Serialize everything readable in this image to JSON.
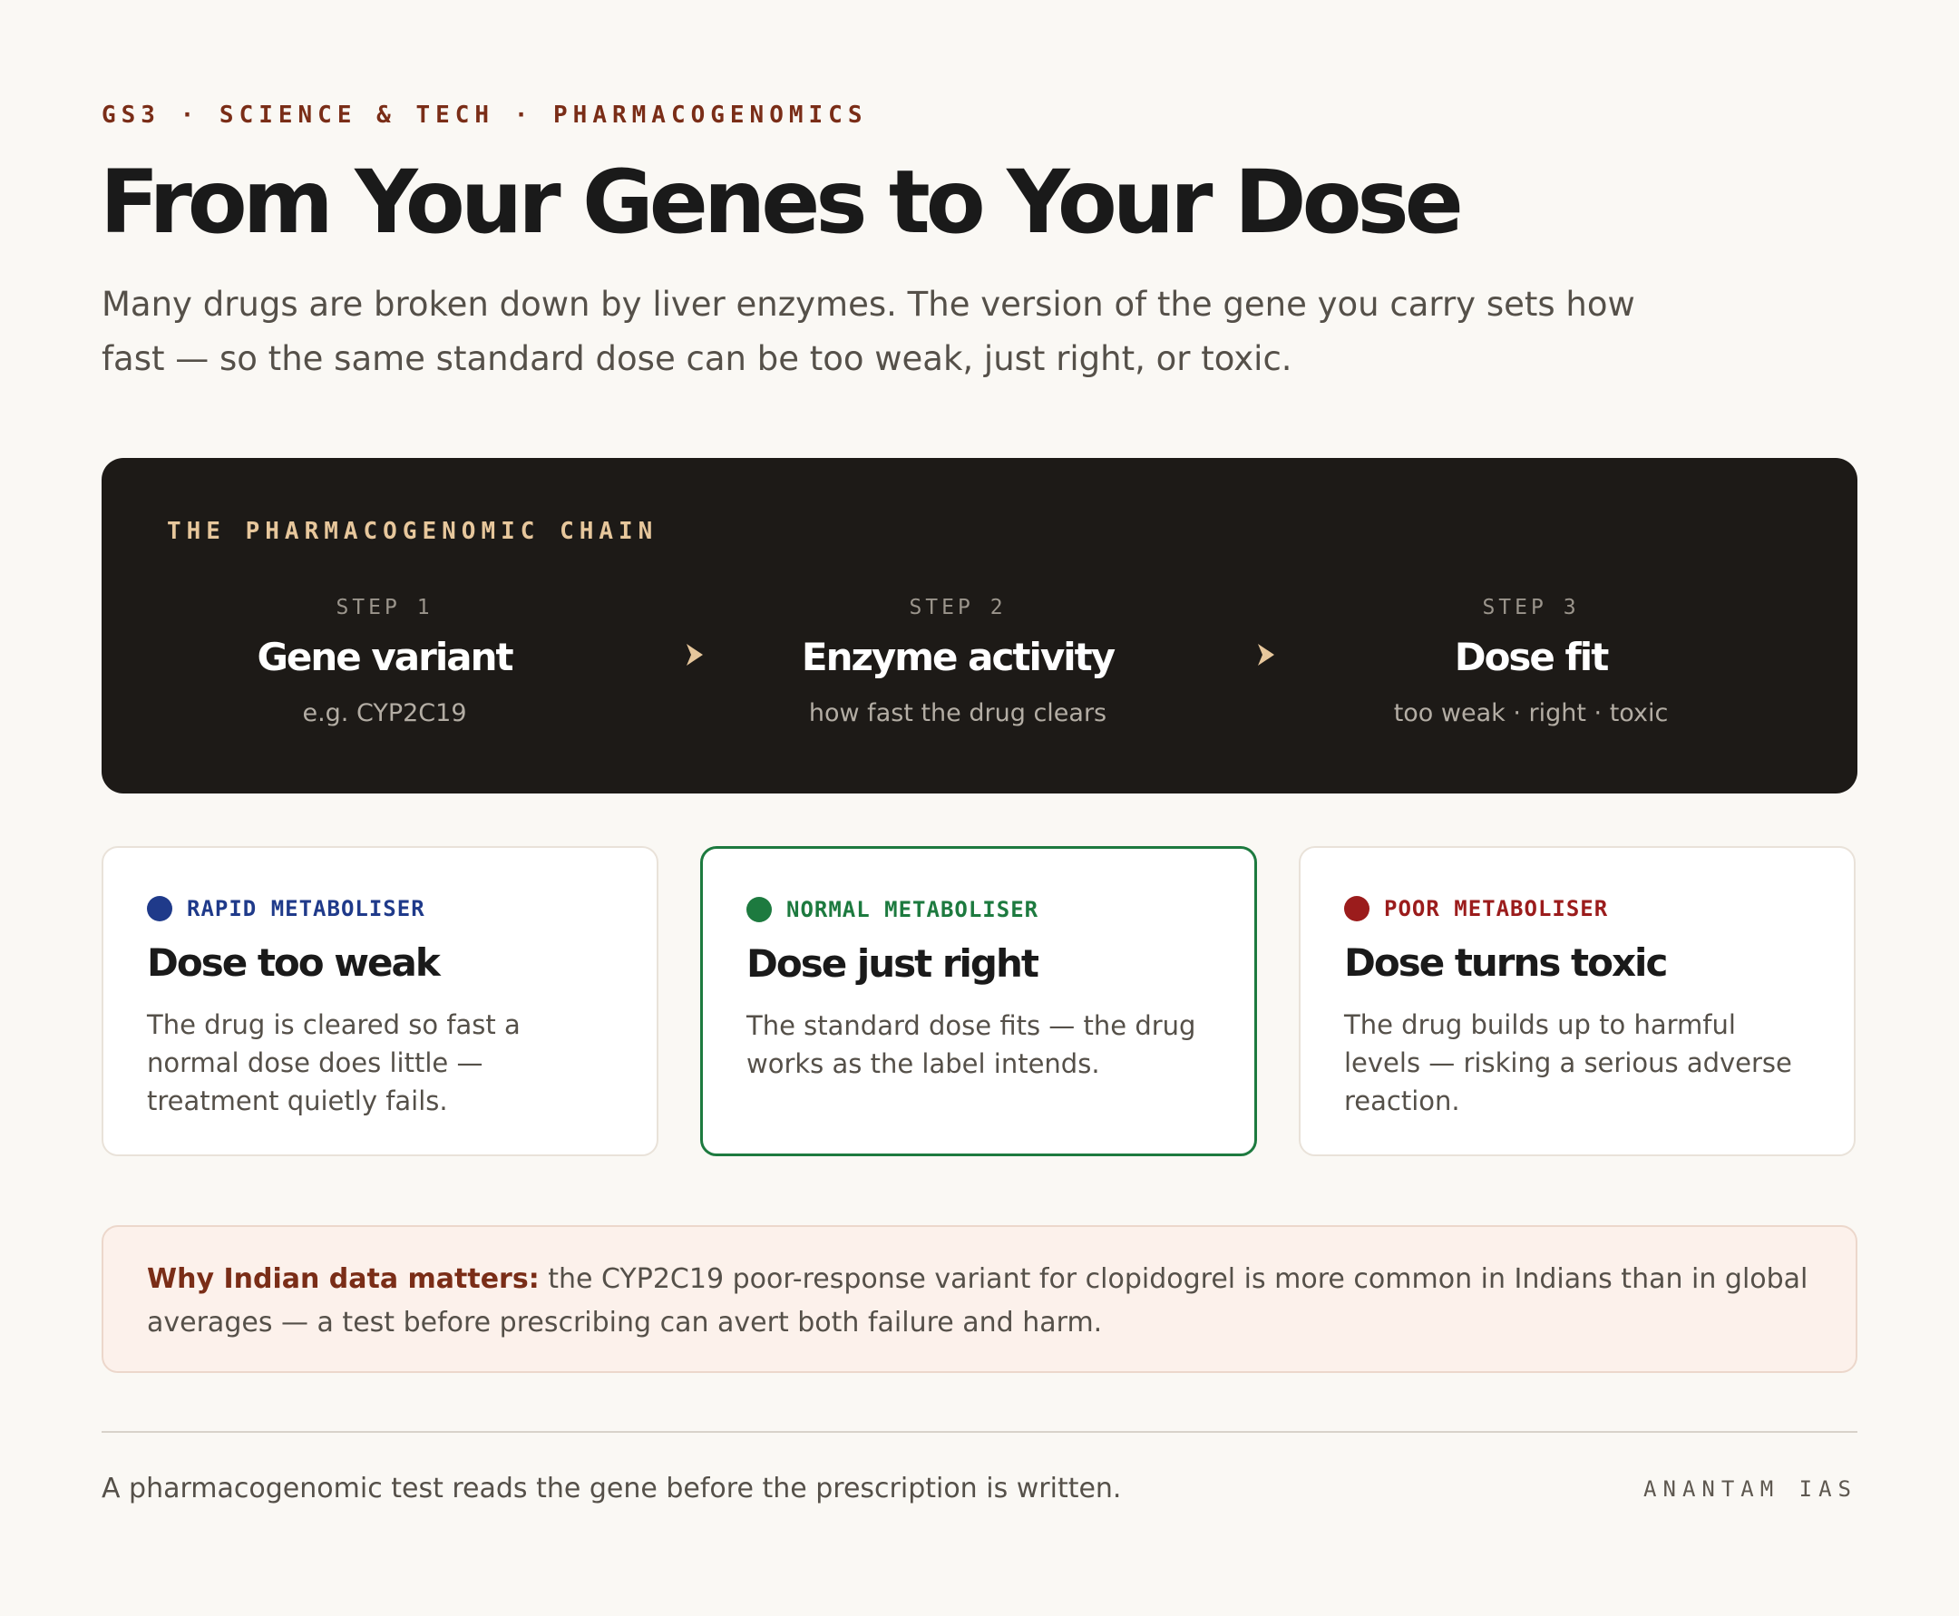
{
  "header": {
    "kicker": "GS3 · SCIENCE & TECH · PHARMACOGENOMICS",
    "title": "From Your Genes to Your Dose",
    "intro": "Many drugs are broken down by liver enzymes. The version of the gene you carry sets how fast — so the same standard dose can be too weak, just right, or toxic."
  },
  "chain": {
    "label": "THE PHARMACOGENOMIC CHAIN",
    "steps": [
      {
        "num": "STEP 1",
        "title": "Gene variant",
        "sub": "e.g. CYP2C19"
      },
      {
        "num": "STEP 2",
        "title": "Enzyme activity",
        "sub": "how fast the drug clears"
      },
      {
        "num": "STEP 3",
        "title": "Dose fit",
        "sub": "too weak · right · toxic"
      }
    ],
    "arrow_icon": "chevron-right-icon",
    "colors": {
      "background": "#1d1a17",
      "label": "#e7c79c",
      "arrow": "#e7c79c"
    }
  },
  "cards": [
    {
      "tag": "RAPID METABOLISER",
      "title": "Dose too weak",
      "body": "The drug is cleared so fast a normal dose does little — treatment quietly fails.",
      "color": "#1f3a8a"
    },
    {
      "tag": "NORMAL METABOLISER",
      "title": "Dose just right",
      "body": "The standard dose fits — the drug works as the label intends.",
      "color": "#1d7a3f"
    },
    {
      "tag": "POOR METABOLISER",
      "title": "Dose turns toxic",
      "body": "The drug builds up to harmful levels — risking a serious adverse reaction.",
      "color": "#9b1c1c"
    }
  ],
  "callout": {
    "lead": "Why Indian data matters:",
    "text": " the CYP2C19 poor-response variant for clopidogrel is more common in Indians than in global averages — a test before prescribing can avert both failure and harm."
  },
  "footer": {
    "text": "A pharmacogenomic test reads the gene before the prescription is written.",
    "brand": "ANANTAM IAS"
  }
}
